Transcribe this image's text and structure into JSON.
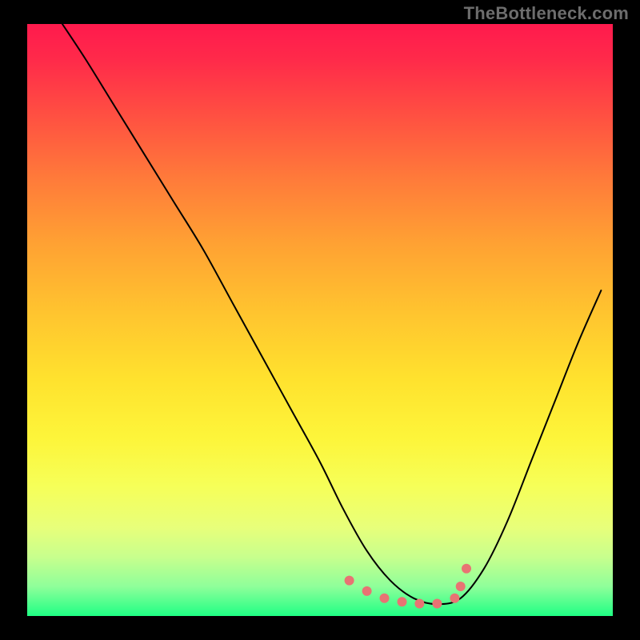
{
  "watermark": "TheBottleneck.com",
  "chart_data": {
    "type": "line",
    "title": "",
    "xlabel": "",
    "ylabel": "",
    "xlim": [
      0,
      100
    ],
    "ylim": [
      0,
      100
    ],
    "grid": false,
    "legend": false,
    "series": [
      {
        "name": "bottleneck-curve",
        "x": [
          6,
          10,
          15,
          20,
          25,
          30,
          35,
          40,
          45,
          50,
          54,
          58,
          62,
          66,
          70,
          74,
          78,
          82,
          86,
          90,
          94,
          98
        ],
        "y": [
          100,
          94,
          86,
          78,
          70,
          62,
          53,
          44,
          35,
          26,
          18,
          11,
          6,
          3,
          2,
          3,
          8,
          16,
          26,
          36,
          46,
          55
        ]
      }
    ],
    "marker_points": {
      "name": "optimal-zone-markers",
      "x": [
        55,
        58,
        61,
        64,
        67,
        70,
        73,
        74,
        75
      ],
      "y": [
        6.0,
        4.2,
        3.0,
        2.4,
        2.1,
        2.1,
        3.0,
        5.0,
        8.0
      ]
    },
    "gradient_stops": [
      {
        "pos": 0,
        "color": "#ff1a4d"
      },
      {
        "pos": 50,
        "color": "#ffd22e"
      },
      {
        "pos": 100,
        "color": "#1fff84"
      }
    ]
  }
}
